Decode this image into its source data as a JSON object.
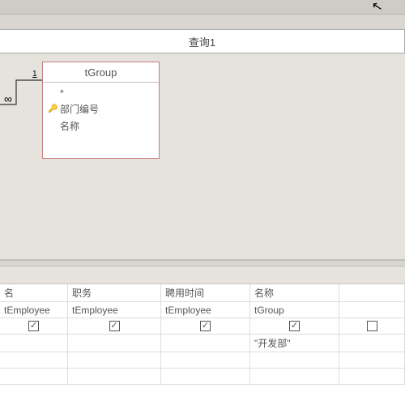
{
  "tab": {
    "title": "查询1"
  },
  "cursor": "↖",
  "table": {
    "name": "tGroup",
    "fields": [
      "*",
      "部门编号",
      "名称"
    ],
    "keyIndex": 1,
    "relation": {
      "one": "1",
      "many": "∞"
    }
  },
  "grid": {
    "columns": [
      {
        "field": "名",
        "table": "tEmployee",
        "show": true,
        "criteria": ""
      },
      {
        "field": "职务",
        "table": "tEmployee",
        "show": true,
        "criteria": ""
      },
      {
        "field": "聘用时间",
        "table": "tEmployee",
        "show": true,
        "criteria": ""
      },
      {
        "field": "名称",
        "table": "tGroup",
        "show": true,
        "criteria": "\"开发部\""
      },
      {
        "field": "",
        "table": "",
        "show": false,
        "criteria": ""
      }
    ],
    "checkMark": "✓"
  }
}
